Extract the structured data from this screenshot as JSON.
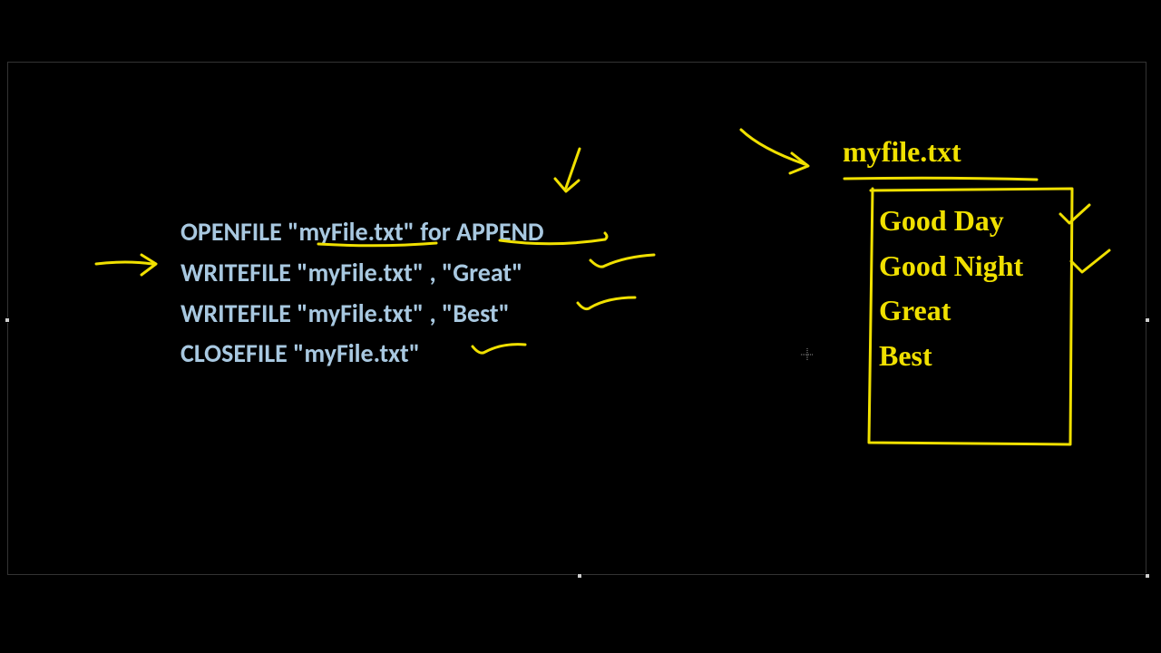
{
  "code": {
    "line1": "OPENFILE \"myFile.txt\" for APPEND",
    "line2": "WRITEFILE \"myFile.txt\" , \"Great\"",
    "line3": "WRITEFILE \"myFile.txt\" , \"Best\"",
    "line4": "CLOSEFILE \"myFile.txt\""
  },
  "file": {
    "name": "myfile.txt",
    "lines": [
      "Good Day",
      "Good Night",
      "Great",
      "Best"
    ]
  },
  "colors": {
    "annotation": "#f0e000",
    "code_text": "#a8c8e0",
    "background": "#000000"
  }
}
